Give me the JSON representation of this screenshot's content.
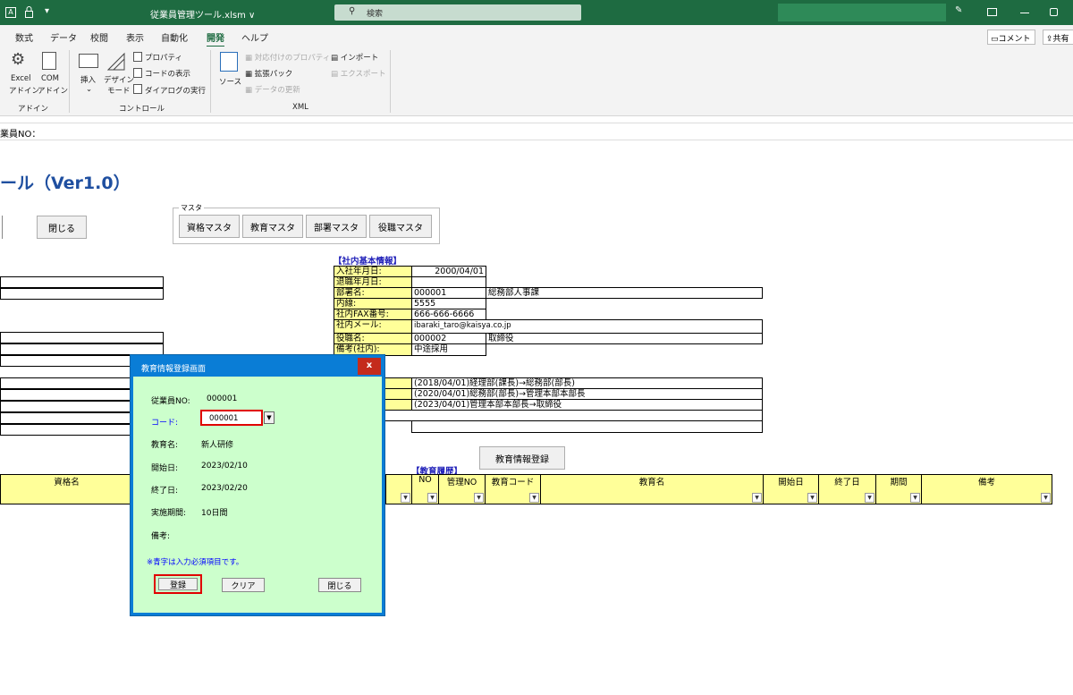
{
  "titlebar": {
    "workbook": "従業員管理ツール.xlsm ∨",
    "search_placeholder": "検索",
    "quick_icon": "A"
  },
  "ribbon": {
    "tabs": [
      "数式",
      "データ",
      "校閲",
      "表示",
      "自動化",
      "開発",
      "ヘルプ"
    ],
    "active_tab": "開発",
    "comment_label": "コメント",
    "share_label": "共有",
    "excel_addin": [
      "Excel",
      "アドイン"
    ],
    "com_addin": [
      "COM",
      "アドイン"
    ],
    "group_addin": "アドイン",
    "insert": "挿入",
    "design_mode": [
      "デザイン",
      "モード"
    ],
    "properties": "プロパティ",
    "view_code": "コードの表示",
    "run_dialog": "ダイアログの実行",
    "group_controls": "コントロール",
    "source": "ソース",
    "map_properties": "対応付けのプロパティ",
    "expansion_packs": "拡張パック",
    "refresh_data": "データの更新",
    "import": "インポート",
    "export": "エクスポート",
    "group_xml": "XML"
  },
  "formula_bar": {
    "text": "業員NO："
  },
  "sheet": {
    "title": "ール（Ver1.0）",
    "close_button": "閉じる",
    "master_group_label": "マスタ",
    "master_buttons": [
      "資格マスタ",
      "教育マスタ",
      "部署マスタ",
      "役職マスタ"
    ],
    "internal_info_title": "【社内基本情報】",
    "info_rows": [
      {
        "label": "入社年月日:",
        "value": "2000/04/01",
        "extra": ""
      },
      {
        "label": "退職年月日:",
        "value": "",
        "extra": ""
      },
      {
        "label": "部署名:",
        "value": "000001",
        "extra": "総務部人事課"
      },
      {
        "label": "内線:",
        "value": "5555",
        "extra": ""
      },
      {
        "label": "社内FAX番号:",
        "value": "666-666-6666",
        "extra": ""
      },
      {
        "label": "社内メール:",
        "value": "ibaraki_taro@kaisya.co.jp",
        "extra": ""
      },
      {
        "label": "役職名:",
        "value": "000002",
        "extra": "取締役"
      },
      {
        "label": "備考(社内):",
        "value": "中途採用",
        "extra": ""
      }
    ],
    "history": [
      "(2018/04/01)経理部(課長)→総務部(部長)",
      "(2020/04/01)総務部(部長)→管理本部本部長",
      "(2023/04/01)管理本部本部長→取締役"
    ],
    "edu_register_button": "教育情報登録",
    "edu_history_title": "【教育履歴】",
    "qual_header": "資格名",
    "edu_headers": [
      "NO",
      "管理NO",
      "教育コード",
      "教育名",
      "開始日",
      "終了日",
      "期間",
      "備考"
    ]
  },
  "dialog": {
    "title": "教育情報登録画面",
    "close_glyph": "x",
    "employee_no_label": "従業員NO:",
    "employee_no_value": "000001",
    "code_label": "コード:",
    "code_value": "000001",
    "edu_name_label": "教育名:",
    "edu_name_value": "新人研修",
    "start_label": "開始日:",
    "start_value": "2023/02/10",
    "end_label": "終了日:",
    "end_value": "2023/02/20",
    "period_label": "実施期間:",
    "period_value": "10日間",
    "note_label": "備考:",
    "required_note": "※青字は入力必須項目です。",
    "register_button": "登録",
    "clear_button": "クリア",
    "close_button": "閉じる"
  },
  "colors": {
    "excel_green": "#1e6b41",
    "dialog_blue": "#0a7dd6",
    "dialog_body": "#ccffcc",
    "cell_yellow": "#ffff99",
    "highlight_red": "#e00000",
    "required_blue": "#0000ff"
  }
}
